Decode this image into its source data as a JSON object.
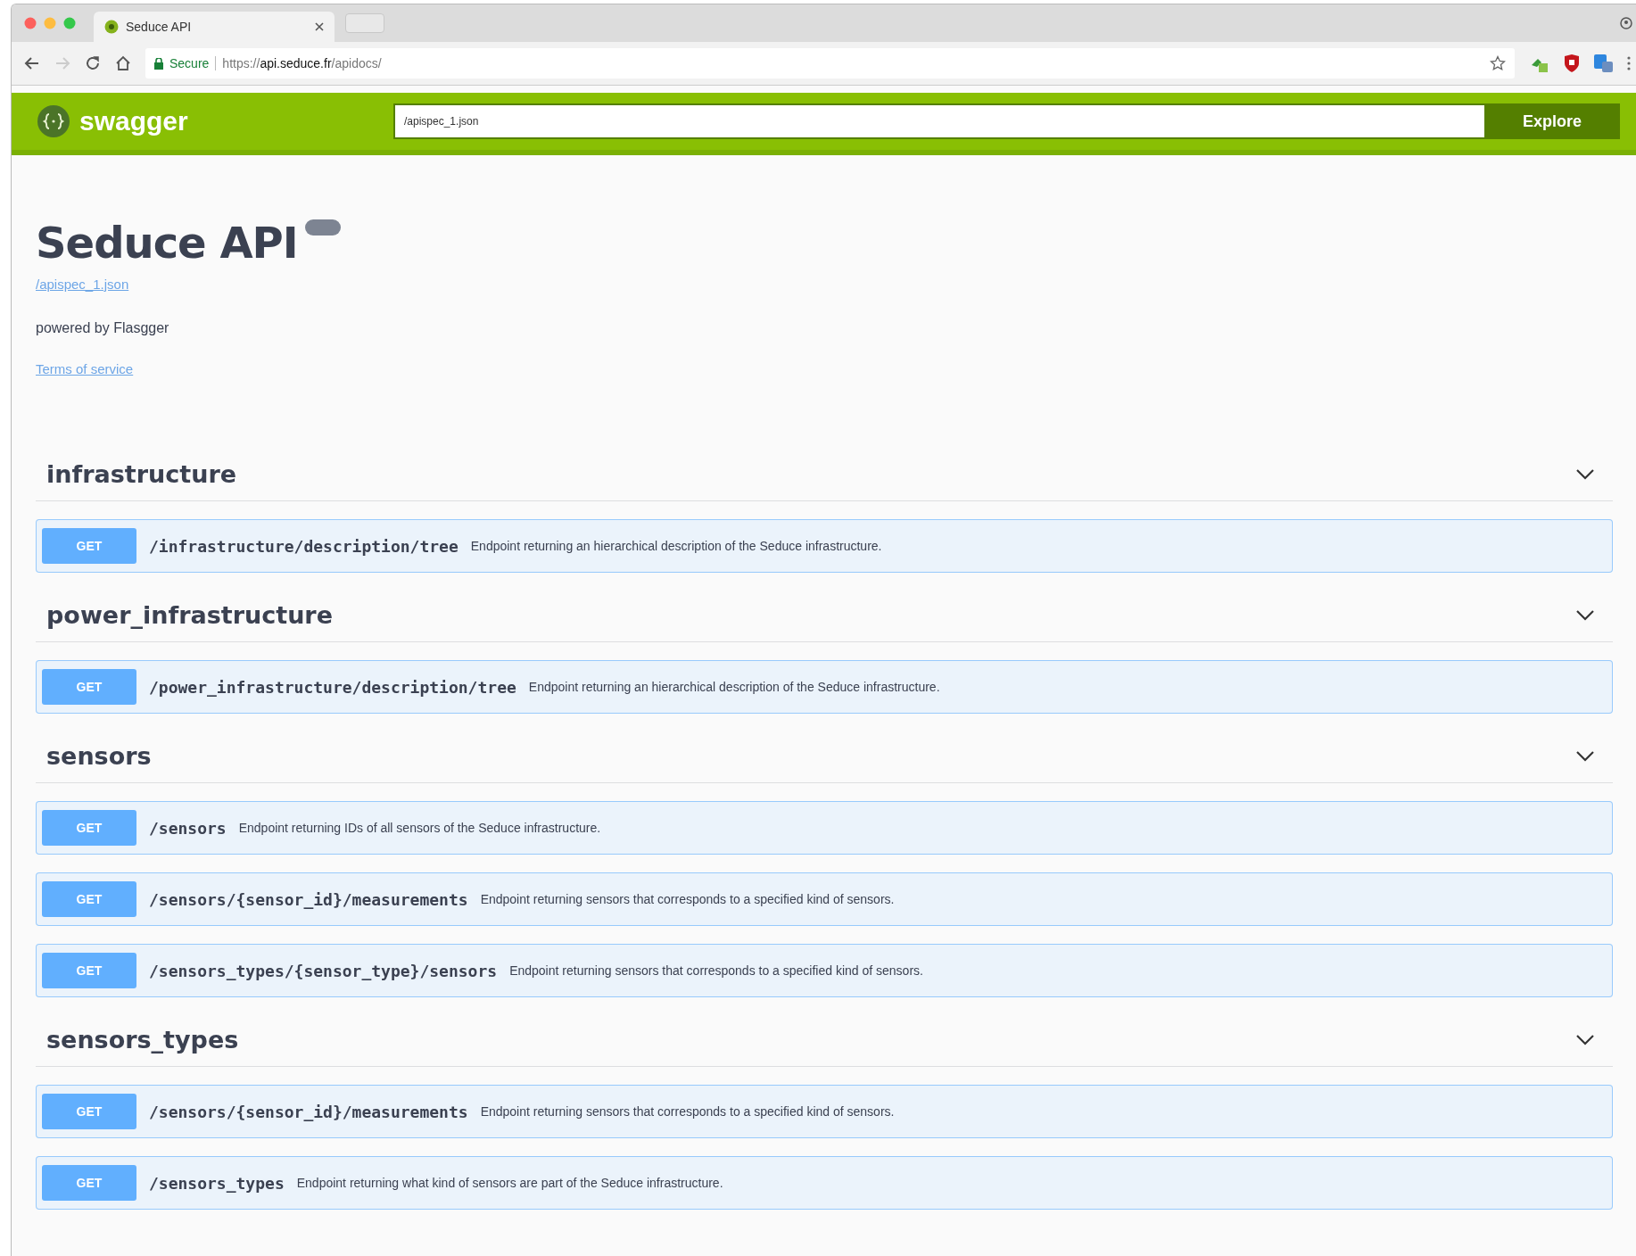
{
  "browser": {
    "tab_title": "Seduce API",
    "secure_label": "Secure",
    "url": {
      "scheme": "https://",
      "host": "api.seduce.fr",
      "path": "/apidocs/"
    }
  },
  "topbar": {
    "logo_text": "swagger",
    "spec_url": "/apispec_1.json",
    "explore_label": "Explore"
  },
  "info": {
    "title": "Seduce API",
    "spec_link": "/apispec_1.json",
    "powered_by": "powered by Flasgger",
    "terms_link": "Terms of service"
  },
  "tags": [
    {
      "name": "infrastructure",
      "expanded": true,
      "operations": [
        {
          "method": "GET",
          "path": "/infrastructure/description/tree",
          "summary": "Endpoint returning an hierarchical description of the Seduce infrastructure."
        }
      ]
    },
    {
      "name": "power_infrastructure",
      "expanded": true,
      "operations": [
        {
          "method": "GET",
          "path": "/power_infrastructure/description/tree",
          "summary": "Endpoint returning an hierarchical description of the Seduce infrastructure."
        }
      ]
    },
    {
      "name": "sensors",
      "expanded": true,
      "operations": [
        {
          "method": "GET",
          "path": "/sensors",
          "summary": "Endpoint returning IDs of all sensors of the Seduce infrastructure."
        },
        {
          "method": "GET",
          "path": "/sensors/{sensor_id}/measurements",
          "summary": "Endpoint returning sensors that corresponds to a specified kind of sensors."
        },
        {
          "method": "GET",
          "path": "/sensors_types/{sensor_type}/sensors",
          "summary": "Endpoint returning sensors that corresponds to a specified kind of sensors."
        }
      ]
    },
    {
      "name": "sensors_types",
      "expanded": true,
      "operations": [
        {
          "method": "GET",
          "path": "/sensors/{sensor_id}/measurements",
          "summary": "Endpoint returning sensors that corresponds to a specified kind of sensors."
        },
        {
          "method": "GET",
          "path": "/sensors_types",
          "summary": "Endpoint returning what kind of sensors are part of the Seduce infrastructure."
        }
      ]
    }
  ]
}
